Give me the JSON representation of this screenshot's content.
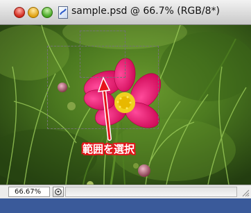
{
  "window": {
    "title": "sample.psd @ 66.7% (RGB/8*)",
    "file_icon": "photoshop-document-icon"
  },
  "titlebar": {
    "buttons": [
      "close",
      "minimize",
      "zoom"
    ]
  },
  "canvas": {
    "image": "pink cosmos flower on green foliage",
    "annotation": "範囲を選択",
    "annotation_color": "#e8141c"
  },
  "status": {
    "zoom": "66.67%",
    "icon": "status-popup-icon"
  }
}
